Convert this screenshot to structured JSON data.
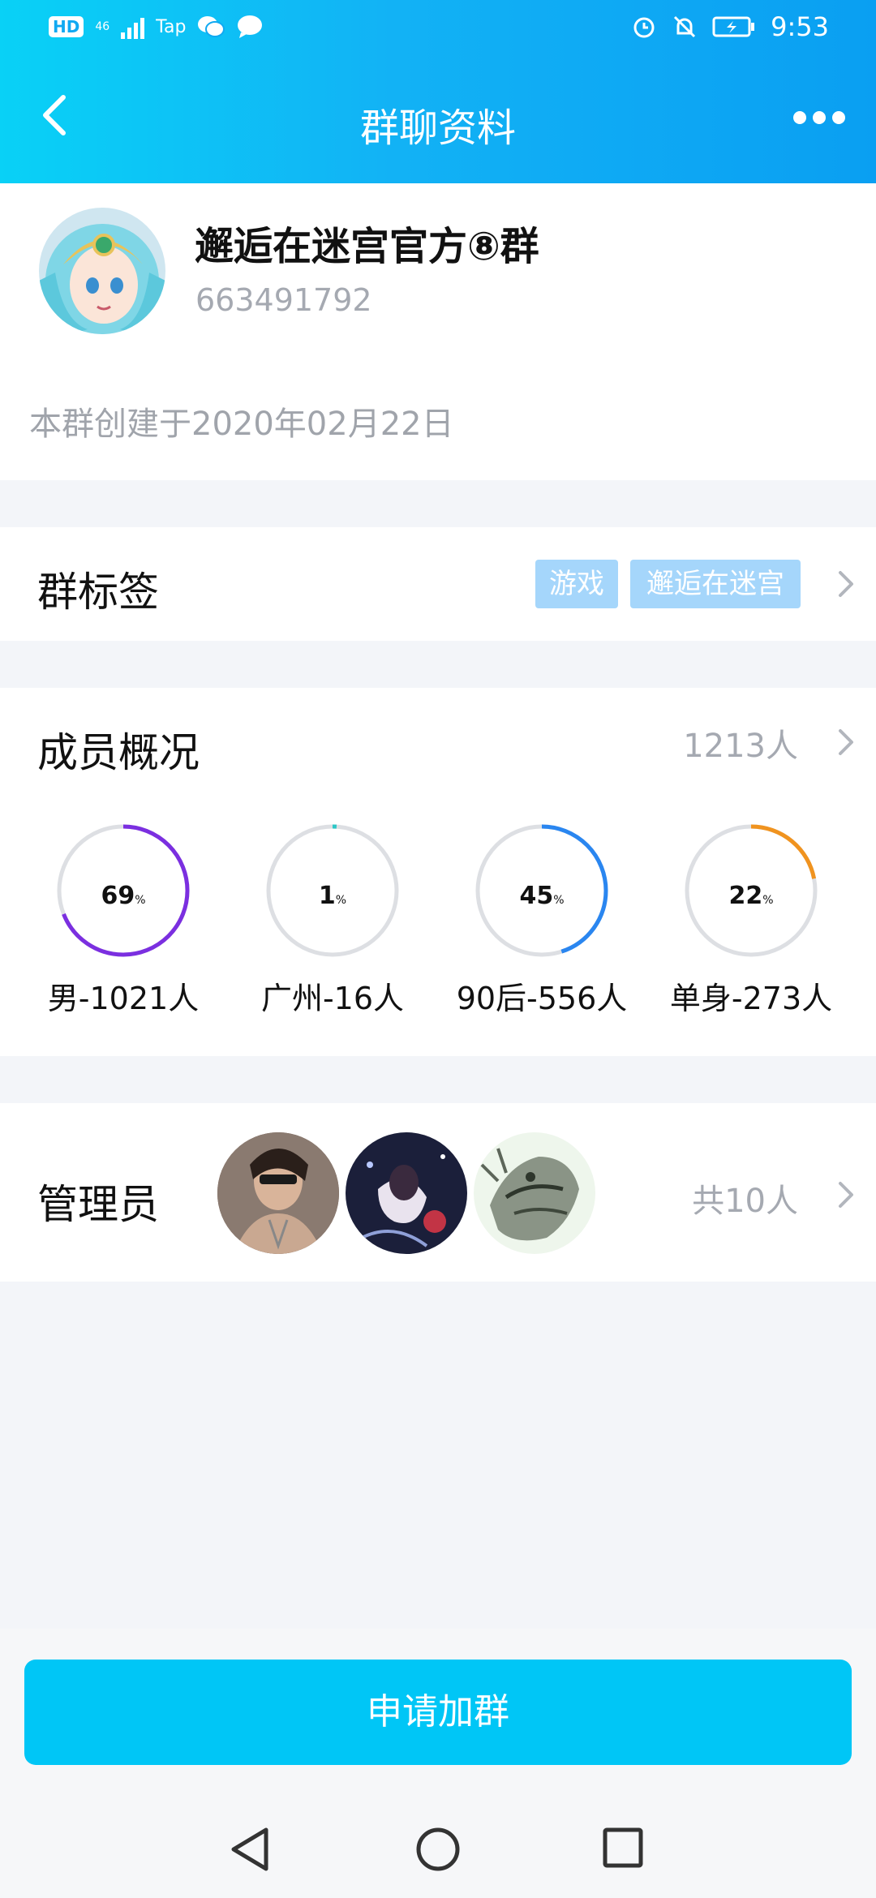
{
  "status_bar": {
    "hd": "HD",
    "network": "46",
    "app_label": "Tap",
    "time": "9:53",
    "icons": [
      "wechat-icon",
      "message-icon",
      "alarm-icon",
      "mute-icon",
      "battery-icon"
    ]
  },
  "header": {
    "title": "群聊资料",
    "back_icon": "back-arrow-icon",
    "more_icon": "more-dots-icon"
  },
  "group": {
    "name": "邂逅在迷宫官方⑧群",
    "id": "663491792",
    "created": "本群创建于2020年02月22日"
  },
  "tags": {
    "label": "群标签",
    "items": [
      "游戏",
      "邂逅在迷宫"
    ]
  },
  "members": {
    "label": "成员概况",
    "count": "1213人",
    "stats": [
      {
        "value": "69",
        "unit": "%",
        "fraction": 0.69,
        "color": "#7b2fe0",
        "label": "男-1021人"
      },
      {
        "value": "1",
        "unit": "%",
        "fraction": 0.01,
        "color": "#2ec7c7",
        "label": "广州-16人"
      },
      {
        "value": "45",
        "unit": "%",
        "fraction": 0.45,
        "color": "#2a86f0",
        "label": "90后-556人"
      },
      {
        "value": "22",
        "unit": "%",
        "fraction": 0.22,
        "color": "#f0931f",
        "label": "单身-273人"
      }
    ]
  },
  "admins": {
    "label": "管理员",
    "count": "共10人"
  },
  "join_button": "申请加群",
  "colors": {
    "accent": "#00c6f6",
    "header_start": "#09d1f6",
    "header_end": "#0a9ff2",
    "tag_bg": "#a5d6fb"
  }
}
